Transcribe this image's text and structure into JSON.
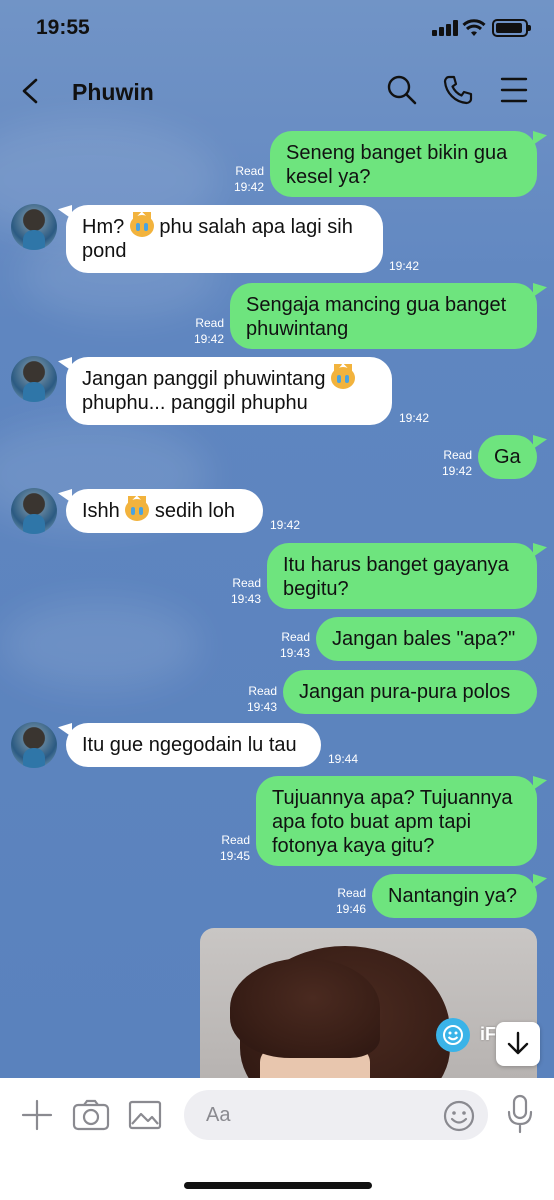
{
  "status_bar": {
    "time": "19:55"
  },
  "header": {
    "back_icon": "chevron-left-icon",
    "title": "Phuwin",
    "icons": [
      "search-icon",
      "phone-icon",
      "menu-icon"
    ]
  },
  "messages": [
    {
      "from": "me",
      "lines": [
        "Seneng banget bikin gua",
        "kesel ya?"
      ],
      "read": "Read",
      "time": "19:42"
    },
    {
      "from": "them",
      "segments": [
        "Hm? ",
        "[emoji]",
        " phu salah apa lagi sih"
      ],
      "line2": "pond",
      "time": "19:42"
    },
    {
      "from": "me",
      "lines": [
        "Sengaja mancing gua banget",
        "phuwintang"
      ],
      "read": "Read",
      "time": "19:42"
    },
    {
      "from": "them",
      "segments": [
        "Jangan panggil phuwintang ",
        "[emoji]"
      ],
      "line2": "phuphu... panggil phuphu",
      "time": "19:42"
    },
    {
      "from": "me",
      "lines": [
        "Ga"
      ],
      "read": "Read",
      "time": "19:42"
    },
    {
      "from": "them",
      "segments": [
        "Ishh ",
        "[emoji]",
        " sedih loh"
      ],
      "time": "19:42"
    },
    {
      "from": "me",
      "lines": [
        "Itu harus banget gayanya",
        "begitu?"
      ],
      "read": "Read",
      "time": "19:43"
    },
    {
      "from": "me",
      "lines": [
        "Jangan bales \"apa?\""
      ],
      "read": "Read",
      "time": "19:43"
    },
    {
      "from": "me",
      "lines": [
        "Jangan pura-pura polos"
      ],
      "read": "Read",
      "time": "19:43"
    },
    {
      "from": "them",
      "segments": [
        "Itu gue ngegodain lu tau"
      ],
      "time": "19:44"
    },
    {
      "from": "me",
      "lines": [
        "Tujuannya apa? Tujuannya",
        "apa foto buat apm tapi",
        "fotonya kaya gitu?"
      ],
      "read": "Read",
      "time": "19:45"
    },
    {
      "from": "me",
      "lines": [
        "Nantangin ya?"
      ],
      "read": "Read",
      "time": "19:46"
    }
  ],
  "emoji_name": "crying-cat-face-icon",
  "watermark": {
    "icon": "smiley-icon",
    "text": "iFake"
  },
  "scroll_button_icon": "arrow-down-icon",
  "input_bar": {
    "icons": [
      "plus-icon",
      "camera-icon",
      "image-icon",
      "emoji-icon",
      "microphone-icon"
    ],
    "placeholder": "Aa"
  },
  "colors": {
    "my_bubble": "#6ee47e",
    "their_bubble": "#ffffff",
    "chat_bg": "#5a82bd"
  }
}
